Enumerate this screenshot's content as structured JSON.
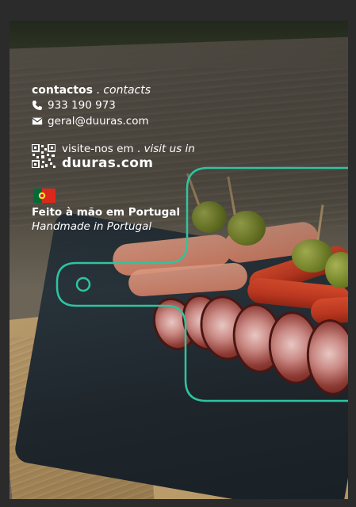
{
  "contacts": {
    "heading_pt": "contactos",
    "separator": " . ",
    "heading_en": "contacts",
    "phone": "933 190 973",
    "email": "geral@duuras.com"
  },
  "website": {
    "visit_pt": "visite-nos em",
    "separator": " . ",
    "visit_en": "visit us in",
    "url": "duuras.com"
  },
  "origin": {
    "made_pt": "Feito à mão em Portugal",
    "made_en": "Handmade in Portugal"
  },
  "icons": {
    "phone": "phone-icon",
    "email": "envelope-icon",
    "qr": "qr-code-icon",
    "flag": "portugal-flag-icon"
  },
  "colors": {
    "outline": "#2ec4a0",
    "text": "#ffffff"
  }
}
